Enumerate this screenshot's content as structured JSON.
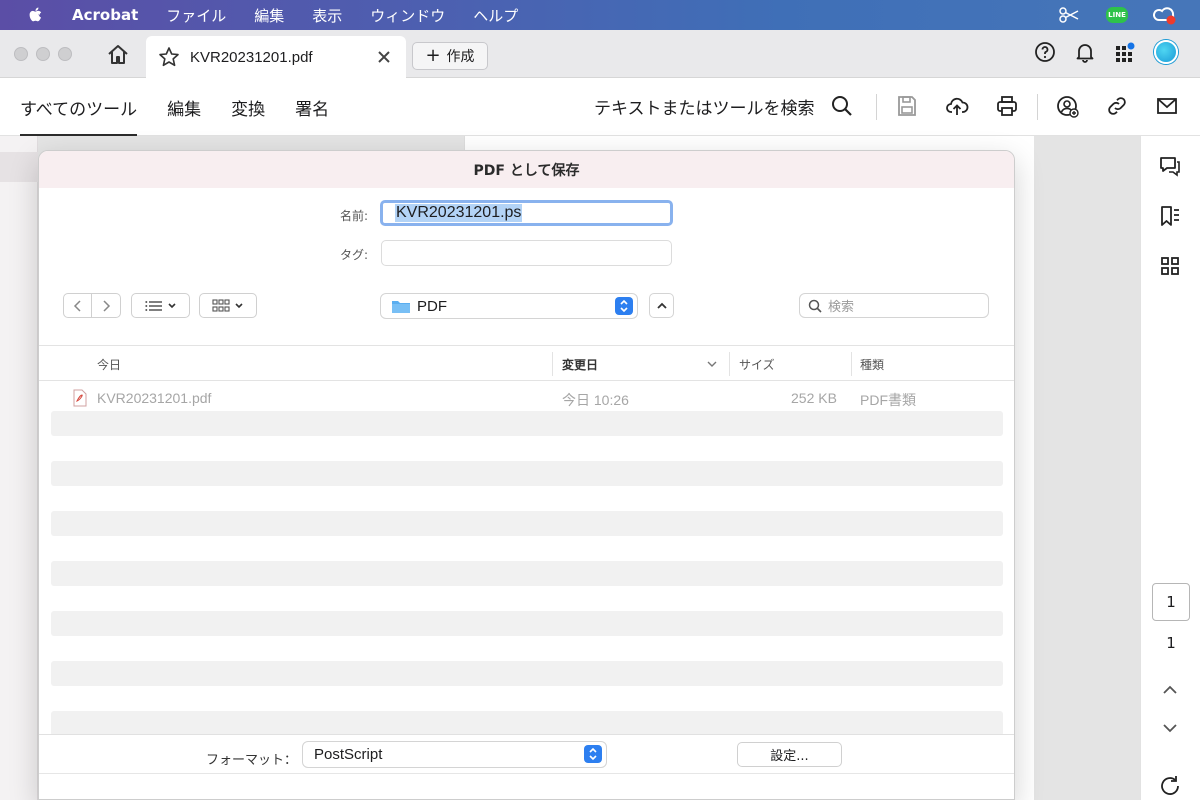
{
  "menubar": {
    "app": "Acrobat",
    "items": [
      "ファイル",
      "編集",
      "表示",
      "ウィンドウ",
      "ヘルプ"
    ],
    "line_label": "LINE"
  },
  "tabbar": {
    "tab_title": "KVR20231201.pdf",
    "create_label": "作成"
  },
  "toolbar": {
    "tabs": [
      "すべてのツール",
      "編集",
      "変換",
      "署名"
    ],
    "search_label": "テキストまたはツールを検索"
  },
  "dialog": {
    "title": "PDF として保存",
    "name_label": "名前:",
    "name_value": "KVR20231201.ps",
    "tag_label": "タグ:",
    "location": "PDF",
    "search_placeholder": "検索",
    "columns": {
      "name": "今日",
      "modified": "変更日",
      "size": "サイズ",
      "kind": "種類"
    },
    "files": [
      {
        "name": "KVR20231201.pdf",
        "modified": "今日 10:26",
        "size": "252 KB",
        "kind": "PDF書類"
      }
    ],
    "format_label": "フォーマット：",
    "format_value": "PostScript",
    "settings_label": "設定..."
  },
  "rail": {
    "current_page": "1",
    "total_pages": "1"
  },
  "colors": {
    "accent": "#2d7ff0",
    "selection": "#b3d3f6",
    "focus_ring": "#89b2ee"
  }
}
